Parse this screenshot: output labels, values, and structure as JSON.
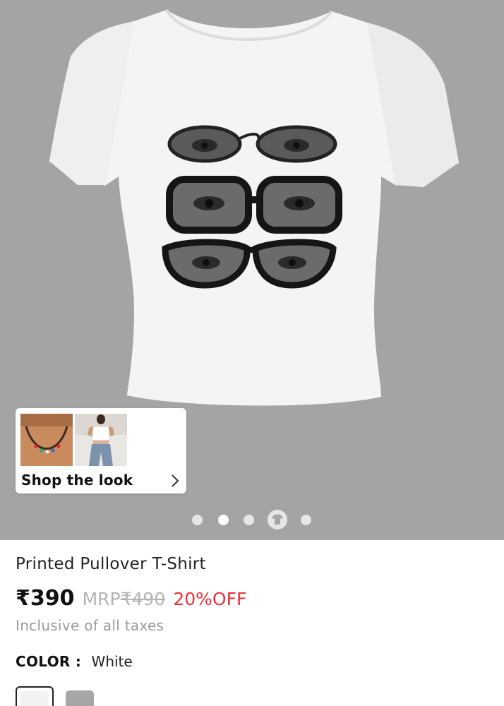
{
  "shop_the_look": {
    "label": "Shop the look"
  },
  "gallery": {
    "slide_count": 5,
    "active_index": 1
  },
  "product": {
    "title": "Printed Pullover T-Shirt",
    "price": "₹390",
    "mrp_label": "MRP",
    "mrp_value": "₹490",
    "discount": "20%OFF",
    "taxes_note": "Inclusive of all taxes"
  },
  "color": {
    "label": "COLOR :",
    "value": "White",
    "swatches": [
      "white",
      "grey"
    ]
  },
  "colors": {
    "hero_bg": "#a3a4a3",
    "discount": "#e8323c",
    "muted": "#9b9b9b"
  }
}
